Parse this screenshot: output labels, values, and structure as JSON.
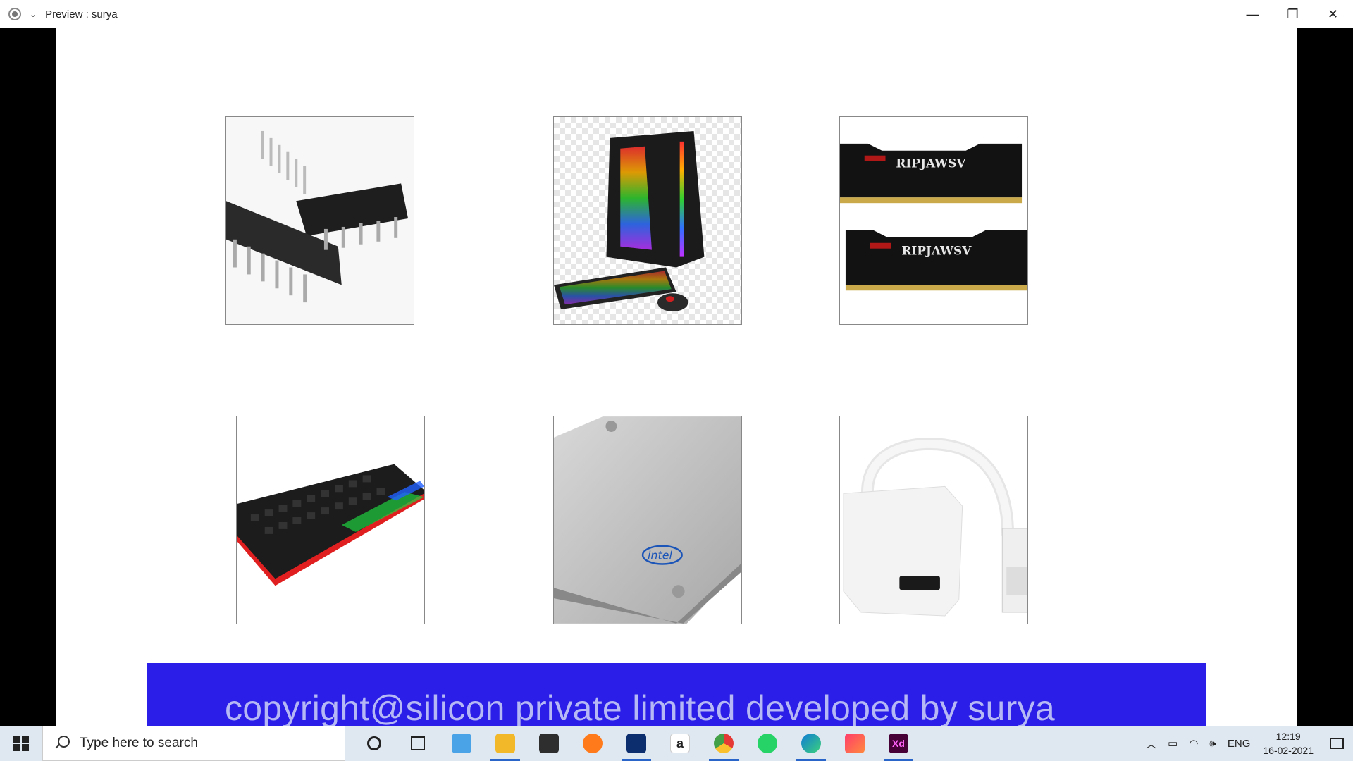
{
  "window": {
    "title": "Preview : surya",
    "minimize_glyph": "—",
    "restore_glyph": "❐",
    "close_glyph": "✕",
    "dropdown_glyph": "⌄"
  },
  "products": [
    {
      "name": "ic-chips",
      "icon": "ic-chip-image"
    },
    {
      "name": "gaming-pc",
      "icon": "desktop-pc-image"
    },
    {
      "name": "ram-modules",
      "icon": "ram-image",
      "label": "RIPJAWSV"
    },
    {
      "name": "rgb-keyboard",
      "icon": "keyboard-image"
    },
    {
      "name": "ssd-drive",
      "icon": "ssd-image",
      "label": "intel"
    },
    {
      "name": "hdmi-adapter",
      "icon": "adapter-image"
    }
  ],
  "footer": {
    "text": "copyright@silicon private limited developed by surya",
    "background": "#2a1ee8",
    "text_color": "#b5b8f5"
  },
  "taskbar": {
    "search_placeholder": "Type here to search",
    "apps": [
      "cortana",
      "task-view",
      "pc",
      "file-explorer",
      "mail",
      "firefox",
      "dropbox",
      "amazon",
      "chrome",
      "whatsapp",
      "edge",
      "creative-cloud",
      "adobe-xd"
    ],
    "xd_label": "Xd",
    "amazon_label": "a",
    "language": "ENG",
    "time": "12:19",
    "date": "16-02-2021"
  }
}
